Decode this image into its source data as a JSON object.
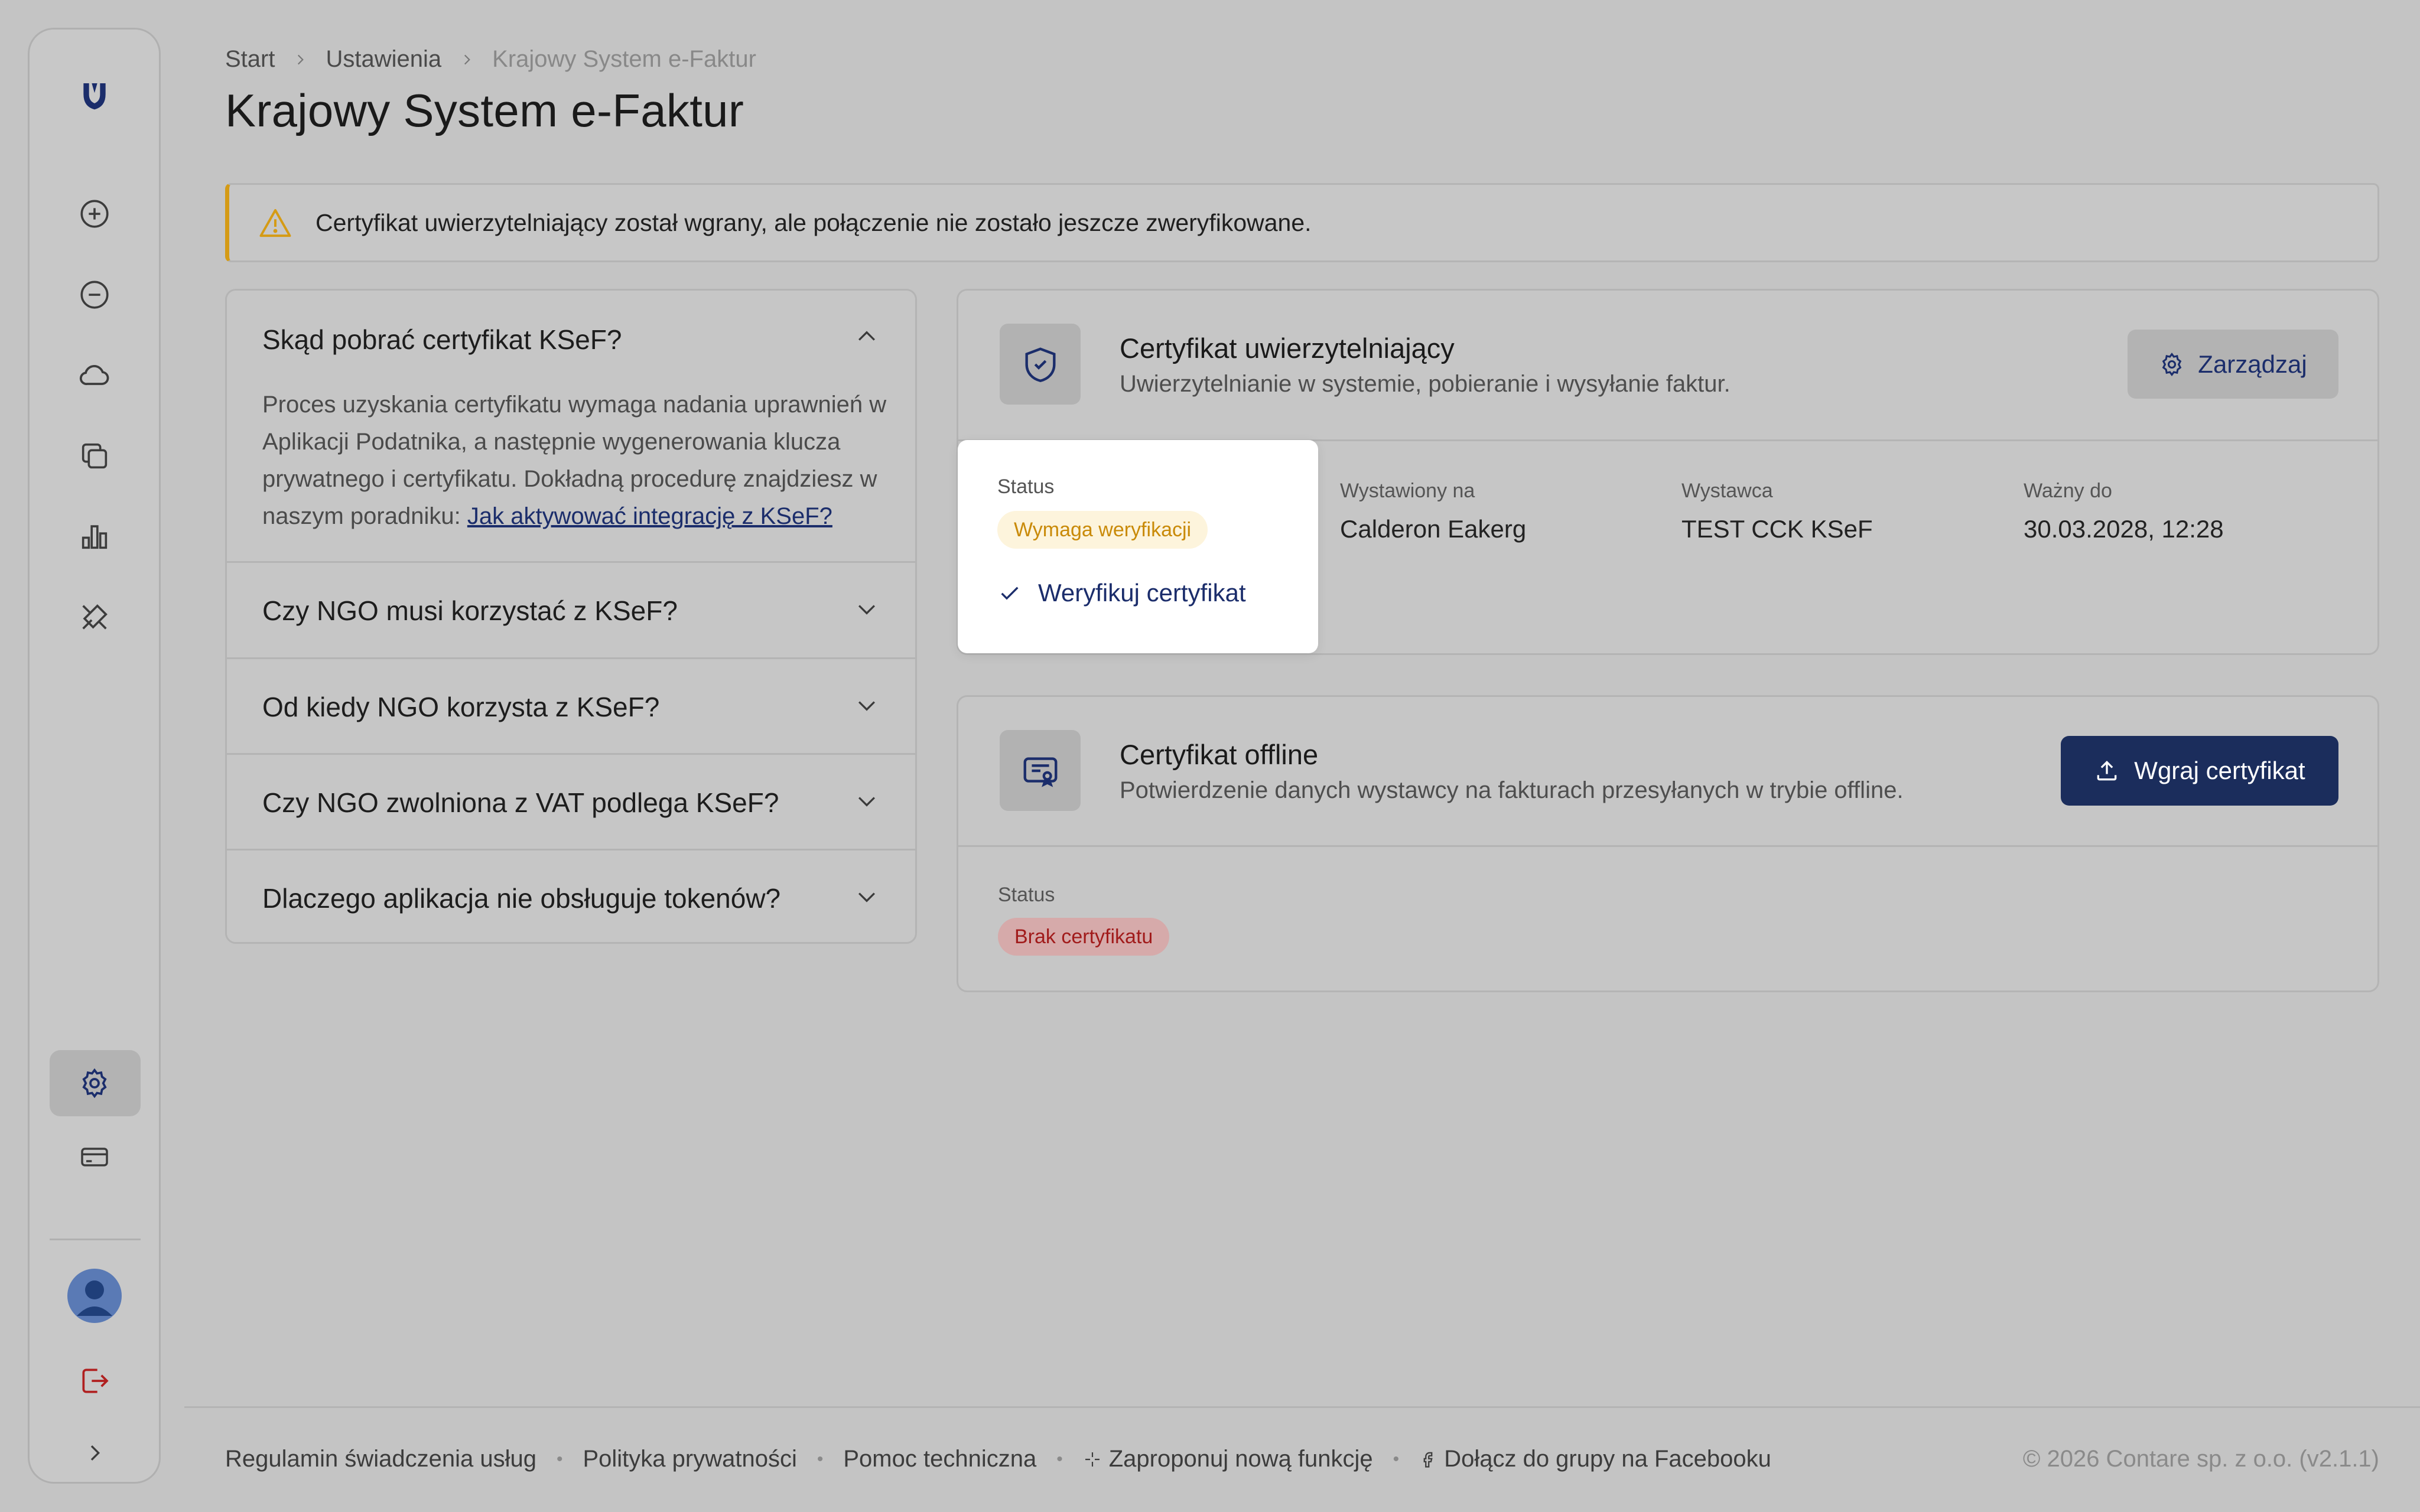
{
  "breadcrumb": {
    "items": [
      "Start",
      "Ustawienia",
      "Krajowy System e-Faktur"
    ]
  },
  "page": {
    "title": "Krajowy System e-Faktur"
  },
  "alert": {
    "text": "Certyfikat uwierzytelniający został wgrany, ale połączenie nie zostało jeszcze zweryfikowane."
  },
  "faq": {
    "items": [
      {
        "question": "Skąd pobrać certyfikat KSeF?",
        "answer": "Proces uzyskania certyfikatu wymaga nadania uprawnień w Aplikacji Podatnika, a następnie wygenerowania klucza prywatnego i certyfikatu. Dokładną procedurę znajdziesz w naszym poradniku:",
        "link": "Jak aktywować integrację z KSeF?"
      },
      {
        "question": "Czy NGO musi korzystać z KSeF?"
      },
      {
        "question": "Od kiedy NGO korzysta z KSeF?"
      },
      {
        "question": "Czy NGO zwolniona z VAT podlega KSeF?"
      },
      {
        "question": "Dlaczego aplikacja nie obsługuje tokenów?"
      }
    ]
  },
  "auth_cert": {
    "title": "Certyfikat uwierzytelniający",
    "subtitle": "Uwierzytelnianie w systemie, pobieranie i wysyłanie faktur.",
    "manage_label": "Zarządzaj",
    "status_label": "Status",
    "status_value": "Wymaga weryfikacji",
    "verify_label": "Weryfikuj certyfikat",
    "issued_to_label": "Wystawiony na",
    "issued_to_value": "Calderon Eakerg",
    "issuer_label": "Wystawca",
    "issuer_value": "TEST CCK KSeF",
    "valid_label": "Ważny do",
    "valid_value": "30.03.2028, 12:28"
  },
  "offline_cert": {
    "title": "Certyfikat offline",
    "subtitle": "Potwierdzenie danych wystawcy na fakturach przesyłanych w trybie offline.",
    "upload_label": "Wgraj certyfikat",
    "status_label": "Status",
    "status_value": "Brak certyfikatu"
  },
  "footer": {
    "links": [
      "Regulamin świadczenia usług",
      "Polityka prywatności",
      "Pomoc techniczna",
      "Zaproponuj nową funkcję",
      "Dołącz do grupy na Facebooku"
    ],
    "copyright": "© 2026 Contare sp. z o.o. (v2.1.1)"
  },
  "colors": {
    "brand": "#1b2d5c",
    "warning": "#d59b15",
    "error": "#a11b1b",
    "overlay_bg": "#c4c4c4"
  },
  "icons": {
    "sidebar": [
      "logo-icon",
      "plus-circle-icon",
      "minus-circle-icon",
      "cloud-icon",
      "copy-icon",
      "chart-bar-icon",
      "tools-icon",
      "gear-icon",
      "card-icon",
      "avatar",
      "logout-icon",
      "chevron-right-icon"
    ]
  }
}
